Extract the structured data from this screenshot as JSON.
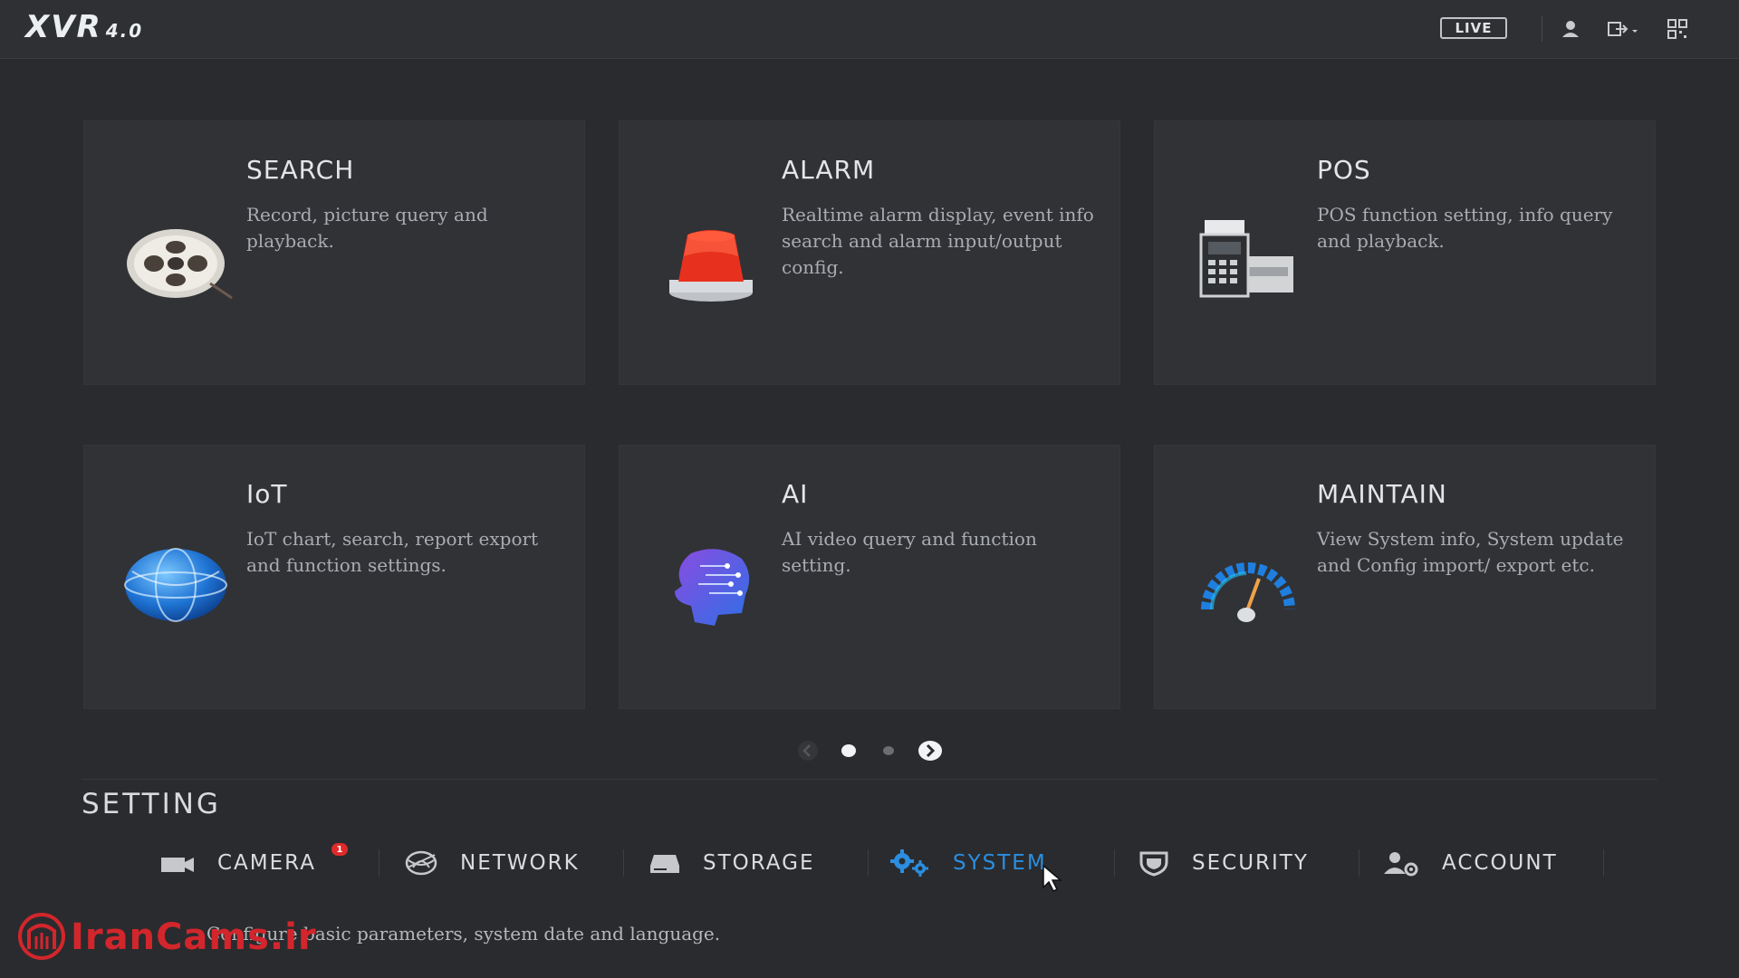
{
  "header": {
    "logo_main": "XVR",
    "logo_version": "4.0",
    "live_label": "LIVE",
    "icons": [
      "user-icon",
      "logout-icon",
      "qrcode-icon"
    ]
  },
  "cards": [
    {
      "title": "SEARCH",
      "desc": "Record, picture query and playback.",
      "icon": "film-reel-icon"
    },
    {
      "title": "ALARM",
      "desc": "Realtime alarm display, event info search and alarm input/output config.",
      "icon": "alarm-light-icon"
    },
    {
      "title": "POS",
      "desc": "POS function setting, info query and playback.",
      "icon": "cash-register-icon"
    },
    {
      "title": "IoT",
      "desc": "IoT chart, search, report export and function settings.",
      "icon": "globe-icon"
    },
    {
      "title": "AI",
      "desc": "AI video query and function setting.",
      "icon": "ai-head-icon"
    },
    {
      "title": "MAINTAIN",
      "desc": "View System info, System update and Config import/ export etc.",
      "icon": "gauge-icon"
    }
  ],
  "pager": {
    "current": 1,
    "total": 2
  },
  "setting": {
    "title": "SETTING",
    "tabs": [
      {
        "label": "CAMERA",
        "icon": "camera-icon",
        "badge": "1"
      },
      {
        "label": "NETWORK",
        "icon": "network-icon"
      },
      {
        "label": "STORAGE",
        "icon": "storage-icon"
      },
      {
        "label": "SYSTEM",
        "icon": "gears-icon",
        "active": true
      },
      {
        "label": "SECURITY",
        "icon": "shield-icon"
      },
      {
        "label": "ACCOUNT",
        "icon": "account-icon"
      }
    ],
    "status_text": "Configure basic parameters, system date and language."
  },
  "watermark": {
    "text": "IranCams.ir"
  },
  "colors": {
    "accent": "#2b8ee0",
    "background": "#2a2b2e",
    "card": "#313236",
    "badge": "#e02a2a"
  }
}
